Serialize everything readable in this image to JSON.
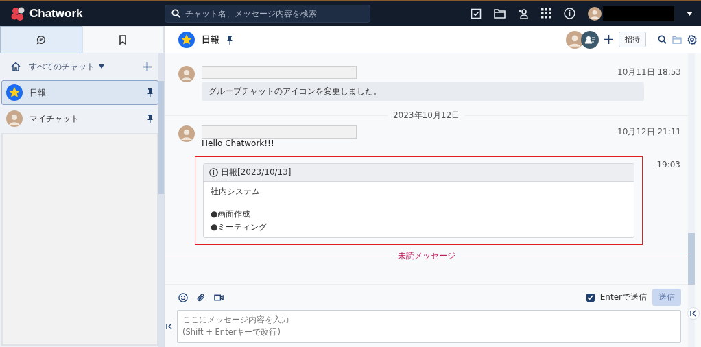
{
  "header": {
    "logo": "Chatwork",
    "search": {
      "placeholder": "チャット名、メッセージ内容を検索"
    }
  },
  "sidebar": {
    "tabs": [
      {
        "kind": "chat",
        "selected": true
      },
      {
        "kind": "bookmark",
        "selected": false
      }
    ],
    "filter": "すべてのチャット",
    "rooms": [
      {
        "name": "日報",
        "kind": "group",
        "selected": true
      },
      {
        "name": "マイチャット",
        "kind": "personal",
        "selected": false
      }
    ]
  },
  "chat": {
    "title": "日報",
    "invite": "招待",
    "timeline": [
      {
        "kind": "notice",
        "time": "10月11日 18:53",
        "body": "グループチャットのアイコンを変更しました。"
      },
      {
        "kind": "date",
        "label": "2023年10月12日"
      },
      {
        "kind": "text",
        "time": "10月12日 21:11",
        "body": "Hello Chatwork!!!"
      },
      {
        "kind": "info",
        "time": "19:03",
        "highlighted": true,
        "title": "日報[2023/10/13]",
        "body": "社内システム",
        "bullets": [
          "●画面作成",
          "●ミーティング"
        ]
      },
      {
        "kind": "unread",
        "label": "未読メッセージ"
      }
    ]
  },
  "composer": {
    "enter_to_send": {
      "label": "Enterで送信",
      "checked": true
    },
    "send": {
      "label": "送信",
      "disabled": true
    },
    "placeholder": "ここにメッセージ内容を入力\n(Shift + Enterキーで改行)"
  }
}
